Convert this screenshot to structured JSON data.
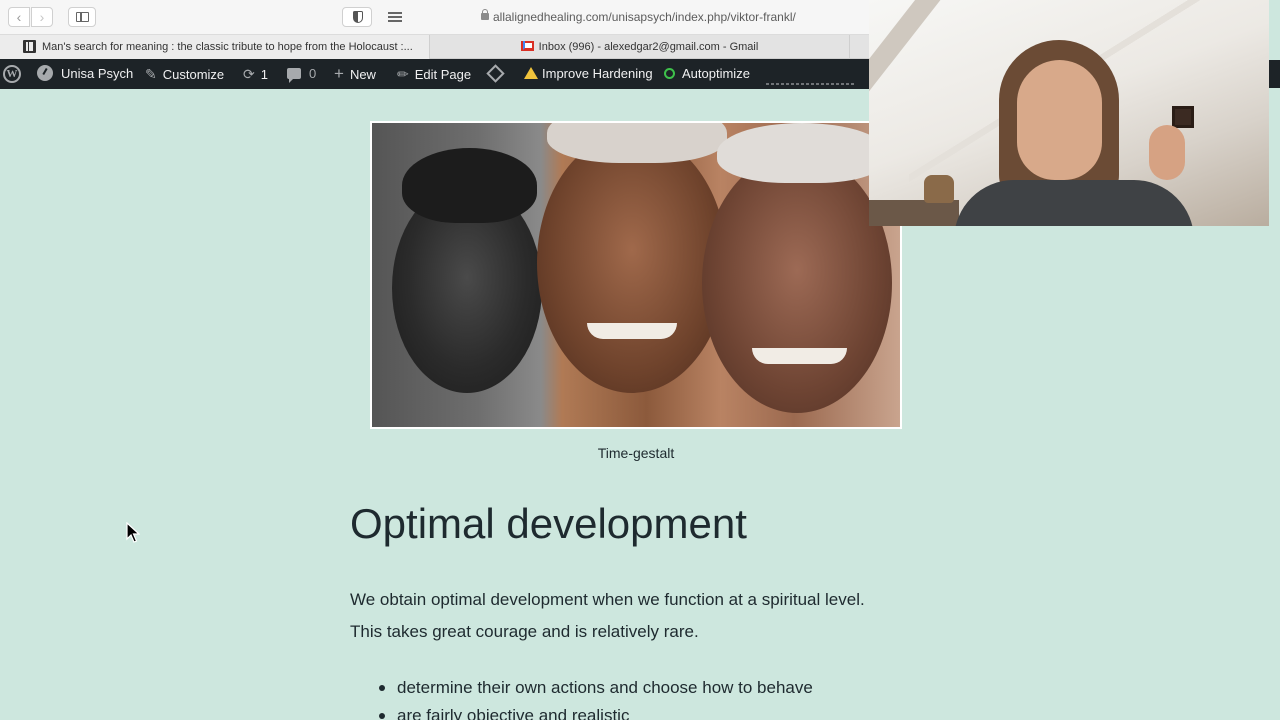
{
  "browser": {
    "url": "allalignedhealing.com/unisapsych/index.php/viktor-frankl/",
    "tabs": [
      {
        "label": "Man's search for meaning : the classic tribute to hope from the Holocaust :..."
      },
      {
        "label": "Inbox (996) - alexedgar2@gmail.com - Gmail"
      }
    ]
  },
  "adminbar": {
    "site_name": "Unisa Psych",
    "customize": "Customize",
    "updates_count": "1",
    "comments_count": "0",
    "new": "New",
    "edit_page": "Edit Page",
    "improve_hardening": "Improve Hardening",
    "autoptimize": "Autoptimize"
  },
  "content": {
    "image_caption": "Time-gestalt",
    "heading": "Optimal development",
    "paragraph_line1": "We obtain optimal development when we function at a spiritual level.",
    "paragraph_line2": "This takes great courage and is relatively rare.",
    "bullets": [
      "determine their own actions and choose how to behave",
      "are fairly objective and realistic"
    ]
  },
  "colors": {
    "page_background": "#cde7de",
    "adminbar_background": "#1d2327",
    "text": "#1e2a2f"
  },
  "icons": [
    "back-icon",
    "forward-icon",
    "sidebar-icon",
    "privacy-shield-icon",
    "reader-icon",
    "lock-icon",
    "book-icon",
    "gmail-icon",
    "wordpress-icon",
    "dashboard-icon",
    "brush-icon",
    "refresh-icon",
    "comment-icon",
    "plus-icon",
    "pencil-icon",
    "diamond-icon",
    "warning-icon",
    "status-circle-icon",
    "cursor-icon"
  ]
}
